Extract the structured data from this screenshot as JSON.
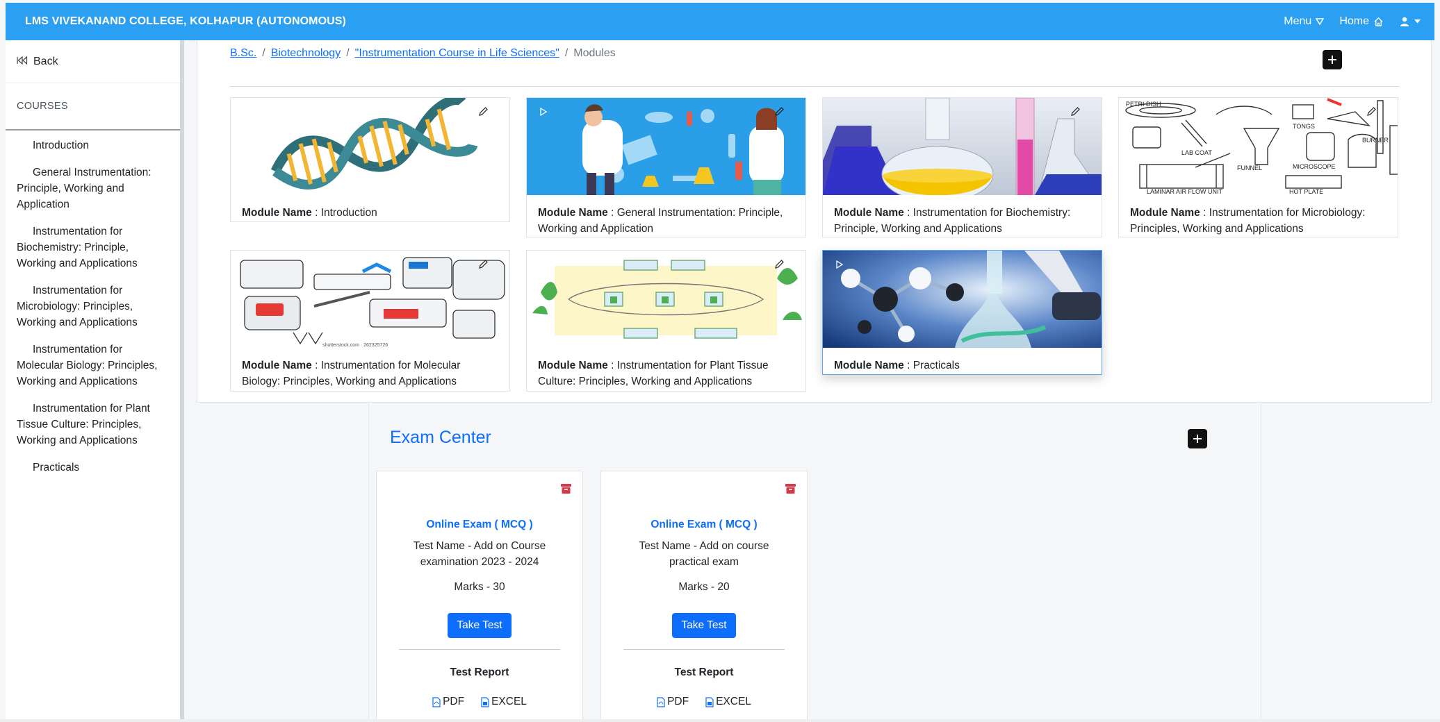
{
  "app": {
    "brand": "LMS VIVEKANAND COLLEGE, KOLHAPUR (AUTONOMOUS)",
    "nav": {
      "menu": "Menu",
      "home": "Home"
    }
  },
  "sidebar": {
    "back": "Back",
    "heading": "COURSES",
    "items": [
      "Introduction",
      "General Instrumentation: Principle, Working and Application",
      "Instrumentation for Biochemistry: Principle, Working and Applications",
      "Instrumentation for Microbiology: Principles, Working and Applications",
      "Instrumentation for Molecular Biology: Principles, Working and Applications",
      "Instrumentation for Plant Tissue Culture: Principles, Working and Applications",
      "Practicals"
    ]
  },
  "breadcrumb": {
    "level1": "B.Sc.",
    "level2": "Biotechnology",
    "level3": "\"Instrumentation Course in Life Sciences\"",
    "current": "Modules",
    "sep": "/"
  },
  "modules": {
    "label": "Module Name",
    "items": [
      {
        "name": "Introduction",
        "image": "dna-helix-illustration",
        "corner_icon": "pencil-icon"
      },
      {
        "name": "General Instrumentation: Principle, Working and Application",
        "image": "scientists-with-lab-instruments",
        "corner_icon": "play-icon"
      },
      {
        "name": "Instrumentation for Biochemistry: Principle, Working and Applications",
        "image": "colored-flasks-photo",
        "corner_icon": "pencil-icon"
      },
      {
        "name": "Instrumentation for Microbiology: Principles, Working and Applications",
        "image": "lab-equipment-sketch",
        "corner_icon": "pencil-icon"
      },
      {
        "name": "Instrumentation for Molecular Biology: Principles, Working and Applications",
        "image": "molecular-biology-devices-sketch",
        "corner_icon": "pencil-icon",
        "image_caption": "shutterstock.com · 262325726"
      },
      {
        "name": "Instrumentation for Plant Tissue Culture: Principles, Working and Applications",
        "image": "plant-tissue-culture-diagram",
        "corner_icon": "pencil-icon"
      },
      {
        "name": "Practicals",
        "image": "molecules-and-microscope-photo",
        "corner_icon": "play-icon"
      }
    ]
  },
  "exam_center": {
    "title": "Exam Center",
    "cards": [
      {
        "type": "Online Exam ( MCQ )",
        "test_name": "Test Name - Add on Course examination 2023 - 2024",
        "marks": "Marks - 30",
        "button": "Take Test",
        "report_title": "Test Report",
        "pdf": "PDF",
        "excel": "EXCEL"
      },
      {
        "type": "Online Exam ( MCQ )",
        "test_name": "Test Name - Add on course practical exam",
        "marks": "Marks - 20",
        "button": "Take Test",
        "report_title": "Test Report",
        "pdf": "PDF",
        "excel": "EXCEL"
      }
    ]
  },
  "colors": {
    "navbar": "#2b9ff1",
    "link": "#0d6efd",
    "danger": "#dc3545",
    "primary_button": "#0d6efd"
  }
}
